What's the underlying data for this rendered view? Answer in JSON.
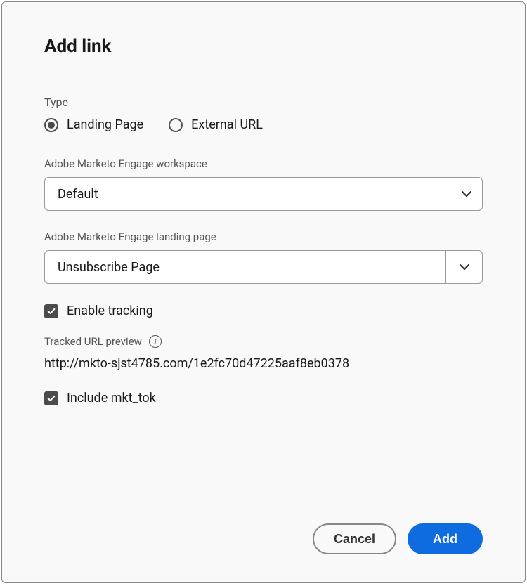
{
  "dialog": {
    "title": "Add link"
  },
  "type": {
    "label": "Type",
    "options": {
      "landing": "Landing Page",
      "external": "External URL"
    }
  },
  "workspace": {
    "label": "Adobe Marketo Engage workspace",
    "value": "Default"
  },
  "landing_page": {
    "label": "Adobe Marketo Engage landing page",
    "value": "Unsubscribe Page"
  },
  "enable_tracking": {
    "label": "Enable tracking",
    "checked": true
  },
  "preview": {
    "label": "Tracked URL preview",
    "url": "http://mkto-sjst4785.com/1e2fc70d47225aaf8eb0378"
  },
  "include_mkttok": {
    "label": "Include mkt_tok",
    "checked": true
  },
  "buttons": {
    "cancel": "Cancel",
    "add": "Add"
  }
}
